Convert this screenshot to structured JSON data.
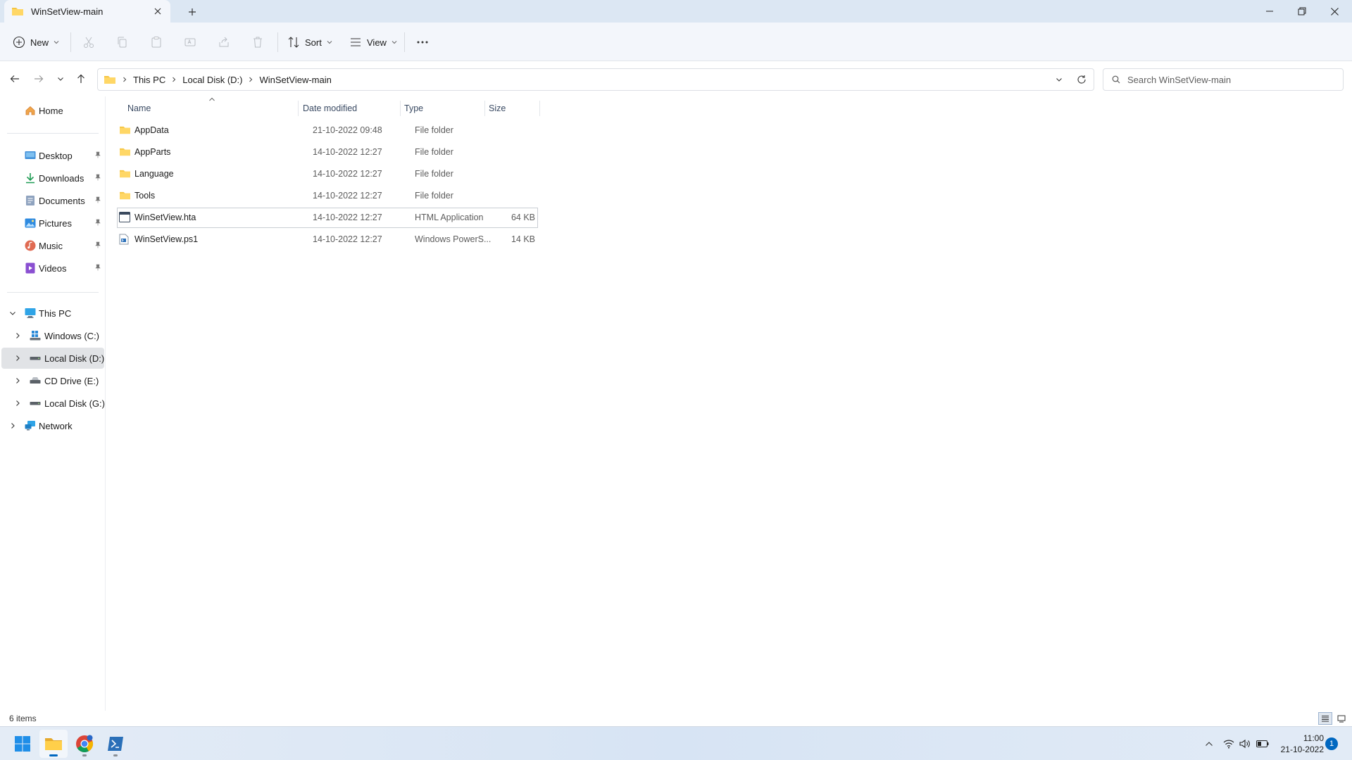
{
  "window": {
    "tab_title": "WinSetView-main"
  },
  "toolbar": {
    "new_label": "New",
    "sort_label": "Sort",
    "view_label": "View"
  },
  "address": {
    "crumbs": [
      "This PC",
      "Local Disk (D:)",
      "WinSetView-main"
    ]
  },
  "search": {
    "placeholder": "Search WinSetView-main"
  },
  "sidebar": {
    "home": "Home",
    "quick_access": [
      "Desktop",
      "Downloads",
      "Documents",
      "Pictures",
      "Music",
      "Videos"
    ],
    "this_pc": "This PC",
    "drives": [
      "Windows (C:)",
      "Local Disk (D:)",
      "CD Drive (E:)",
      "Local Disk (G:)"
    ],
    "network": "Network"
  },
  "columns": {
    "name": "Name",
    "date": "Date modified",
    "type": "Type",
    "size": "Size"
  },
  "files": [
    {
      "name": "AppData",
      "date": "21-10-2022 09:48",
      "type": "File folder",
      "size": ""
    },
    {
      "name": "AppParts",
      "date": "14-10-2022 12:27",
      "type": "File folder",
      "size": ""
    },
    {
      "name": "Language",
      "date": "14-10-2022 12:27",
      "type": "File folder",
      "size": ""
    },
    {
      "name": "Tools",
      "date": "14-10-2022 12:27",
      "type": "File folder",
      "size": ""
    },
    {
      "name": "WinSetView.hta",
      "date": "14-10-2022 12:27",
      "type": "HTML Application",
      "size": "64 KB"
    },
    {
      "name": "WinSetView.ps1",
      "date": "14-10-2022 12:27",
      "type": "Windows PowerS...",
      "size": "14 KB"
    }
  ],
  "status": {
    "count": "6 items"
  },
  "taskbar": {
    "time": "11:00",
    "date": "21-10-2022",
    "notifications": "1"
  },
  "colors": {
    "folder": "#f5c542",
    "accent": "#0067c0"
  }
}
